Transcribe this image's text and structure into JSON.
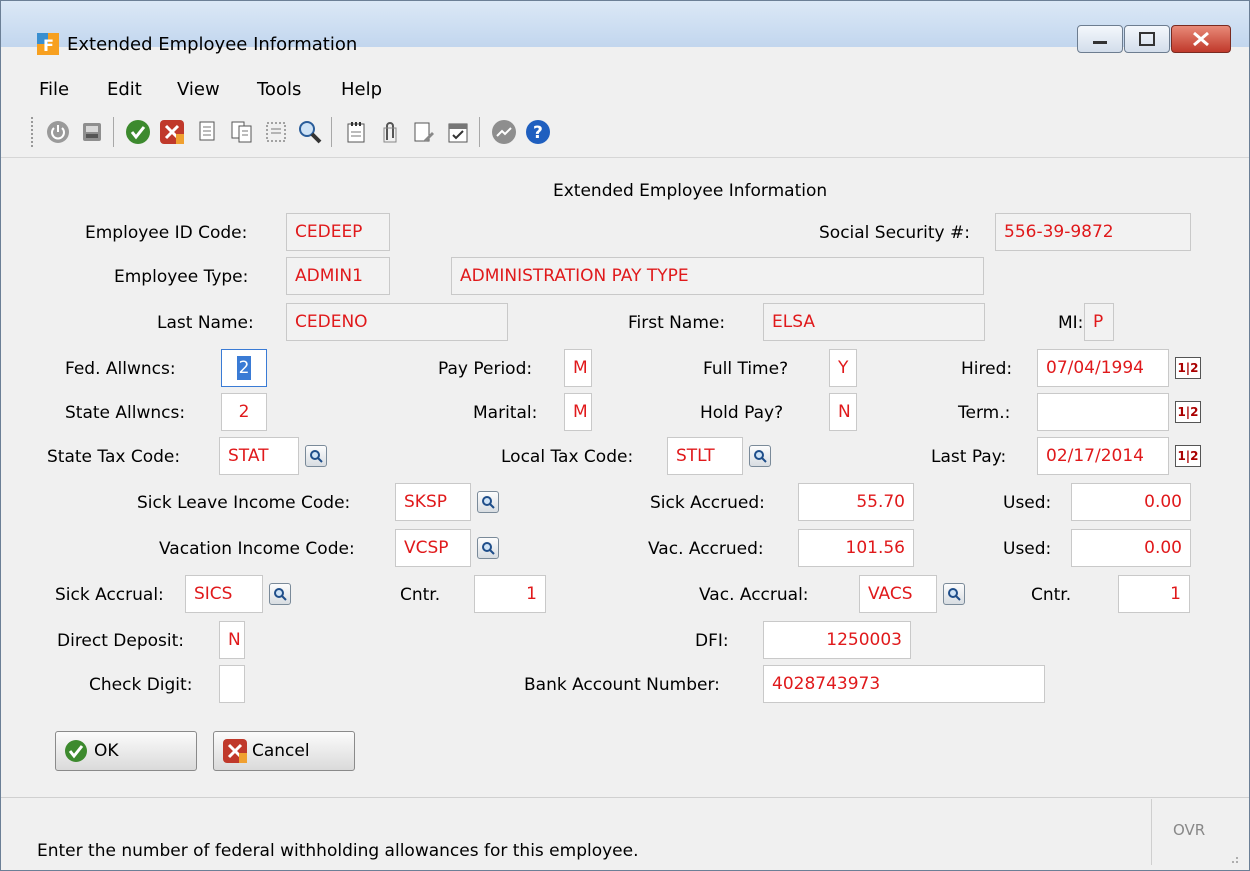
{
  "window": {
    "title": "Extended Employee Information"
  },
  "menu": [
    "File",
    "Edit",
    "View",
    "Tools",
    "Help"
  ],
  "toolbar_icons": [
    "power-icon",
    "print-icon",
    "check-icon",
    "cancel-icon",
    "copy-doc-icon",
    "copy-doc2-icon",
    "select-doc-icon",
    "zoom-icon",
    "notepad-icon",
    "attach-icon",
    "document-edit-icon",
    "calendar-check-icon",
    "chart-icon",
    "help-icon"
  ],
  "form": {
    "heading": "Extended Employee Information",
    "employee_id": {
      "label": "Employee ID Code:",
      "value": "CEDEEP"
    },
    "ssn": {
      "label": "Social Security #:",
      "value": "556-39-9872"
    },
    "employee_type": {
      "label": "Employee Type:",
      "value": "ADMIN1",
      "description": "ADMINISTRATION PAY TYPE"
    },
    "last_name": {
      "label": "Last Name:",
      "value": "CEDENO"
    },
    "first_name": {
      "label": "First Name:",
      "value": "ELSA"
    },
    "mi": {
      "label": "MI:",
      "value": "P"
    },
    "fed_allowances": {
      "label": "Fed. Allwncs:",
      "value": "2"
    },
    "pay_period": {
      "label": "Pay Period:",
      "value": "M"
    },
    "full_time": {
      "label": "Full Time?",
      "value": "Y"
    },
    "hired": {
      "label": "Hired:",
      "value": "07/04/1994"
    },
    "state_allowances": {
      "label": "State Allwncs:",
      "value": "2"
    },
    "marital": {
      "label": "Marital:",
      "value": "M"
    },
    "hold_pay": {
      "label": "Hold Pay?",
      "value": "N"
    },
    "term": {
      "label": "Term.:",
      "value": ""
    },
    "state_tax_code": {
      "label": "State Tax Code:",
      "value": "STAT"
    },
    "local_tax_code": {
      "label": "Local Tax Code:",
      "value": "STLT"
    },
    "last_pay": {
      "label": "Last Pay:",
      "value": "02/17/2014"
    },
    "sick_leave_income_code": {
      "label": "Sick Leave Income Code:",
      "value": "SKSP"
    },
    "sick_accrued": {
      "label": "Sick Accrued:",
      "value": "55.70"
    },
    "sick_used": {
      "label": "Used:",
      "value": "0.00"
    },
    "vacation_income_code": {
      "label": "Vacation Income Code:",
      "value": "VCSP"
    },
    "vac_accrued": {
      "label": "Vac. Accrued:",
      "value": "101.56"
    },
    "vac_used": {
      "label": "Used:",
      "value": "0.00"
    },
    "sick_accrual": {
      "label": "Sick Accrual:",
      "value": "SICS"
    },
    "sick_cntr": {
      "label": "Cntr.",
      "value": "1"
    },
    "vac_accrual": {
      "label": "Vac. Accrual:",
      "value": "VACS"
    },
    "vac_cntr": {
      "label": "Cntr.",
      "value": "1"
    },
    "direct_deposit": {
      "label": "Direct Deposit:",
      "value": "N"
    },
    "dfi": {
      "label": "DFI:",
      "value": "1250003"
    },
    "check_digit": {
      "label": "Check Digit:",
      "value": ""
    },
    "bank_account": {
      "label": "Bank Account Number:",
      "value": "4028743973"
    },
    "calendar_glyph": "1|2"
  },
  "buttons": {
    "ok": "OK",
    "cancel": "Cancel"
  },
  "status": {
    "message": "Enter the number of federal withholding allowances for this employee.",
    "mode": "OVR"
  },
  "colors": {
    "field_text": "#e0191b",
    "accent": "#3a7bd5"
  }
}
